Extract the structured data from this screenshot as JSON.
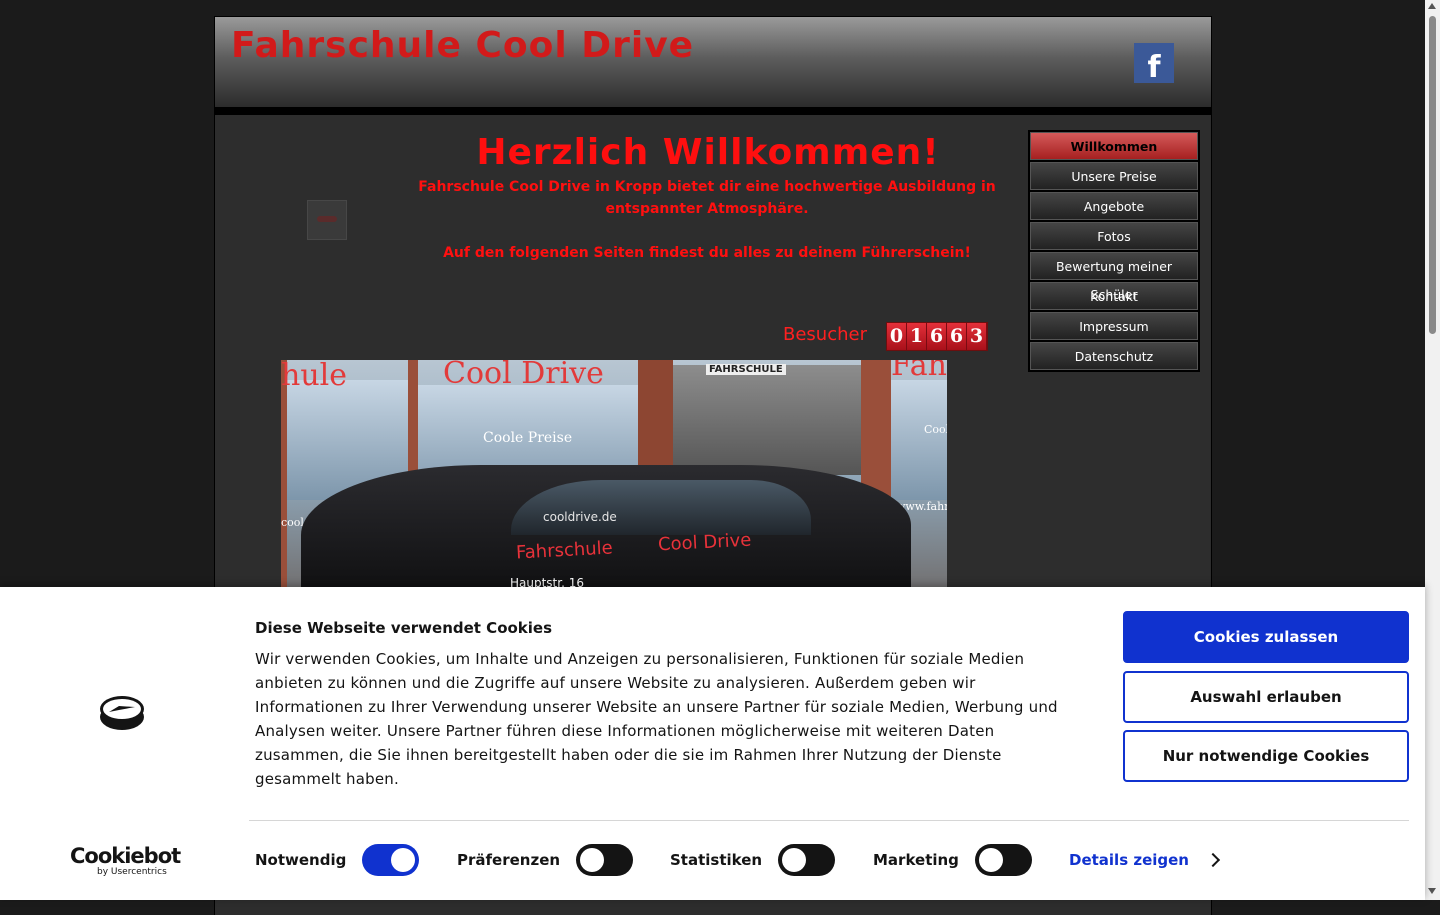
{
  "site": {
    "title": "Fahrschule Cool Drive"
  },
  "welcome": {
    "heading": "Herzlich Willkommen!",
    "line1": "Fahrschule Cool Drive in Kropp bietet dir eine hochwertige Ausbildung in entspannter Atmosphäre.",
    "line2": "Auf den folgenden Seiten findest du alles zu deinem Führerschein!"
  },
  "visitors": {
    "label": "Besucher",
    "digits": [
      "0",
      "1",
      "6",
      "6",
      "3"
    ]
  },
  "nav": {
    "items": [
      {
        "label": "Willkommen"
      },
      {
        "label": "Unsere Preise"
      },
      {
        "label": "Angebote"
      },
      {
        "label": "Fotos"
      },
      {
        "label": "Bewertung meiner Schüler"
      },
      {
        "label": "Kontakt"
      },
      {
        "label": "Impressum"
      },
      {
        "label": "Datenschutz"
      }
    ]
  },
  "hero": {
    "sign_left": "hule",
    "sign_center": "Cool Drive",
    "sign_coole": "Coole Preise",
    "sign_fahrschule": "FAHRSCHULE",
    "sign_right": "Fah",
    "car_fahrschule": "Fahrschule",
    "car_cooldrive": "Cool Drive",
    "car_web": "cooldrive.de",
    "car_address": "Hauptstr. 16",
    "window_web": "cooldrive.de",
    "window_right": "www.fahr",
    "window_cool": "Cool"
  },
  "cookie": {
    "title": "Diese Webseite verwendet Cookies",
    "body": "Wir verwenden Cookies, um Inhalte und Anzeigen zu personalisieren, Funktionen für soziale Medien anbieten zu können und die Zugriffe auf unsere Website zu analysieren. Außerdem geben wir Informationen zu Ihrer Verwendung unserer Website an unsere Partner für soziale Medien, Werbung und Analysen weiter. Unsere Partner führen diese Informationen möglicherweise mit weiteren Daten zusammen, die Sie ihnen bereitgestellt haben oder die sie im Rahmen Ihrer Nutzung der Dienste gesammelt haben.",
    "btn_allow_all": "Cookies zulassen",
    "btn_allow_selection": "Auswahl erlauben",
    "btn_necessary": "Nur notwendige Cookies",
    "toggles": [
      {
        "label": "Notwendig",
        "on": true
      },
      {
        "label": "Präferenzen",
        "on": false
      },
      {
        "label": "Statistiken",
        "on": false
      },
      {
        "label": "Marketing",
        "on": false
      }
    ],
    "details": "Details zeigen",
    "brand": "Cookiebot",
    "brand_sub": "by Usercentrics"
  },
  "colors": {
    "accent_red": "#ff0f0f",
    "cookie_blue": "#1032cf",
    "facebook": "#3b5998"
  },
  "icons": {
    "facebook": "facebook-icon",
    "cookiebot_logo": "cookiebot-logo-icon",
    "chevron": "chevron-right-icon"
  }
}
